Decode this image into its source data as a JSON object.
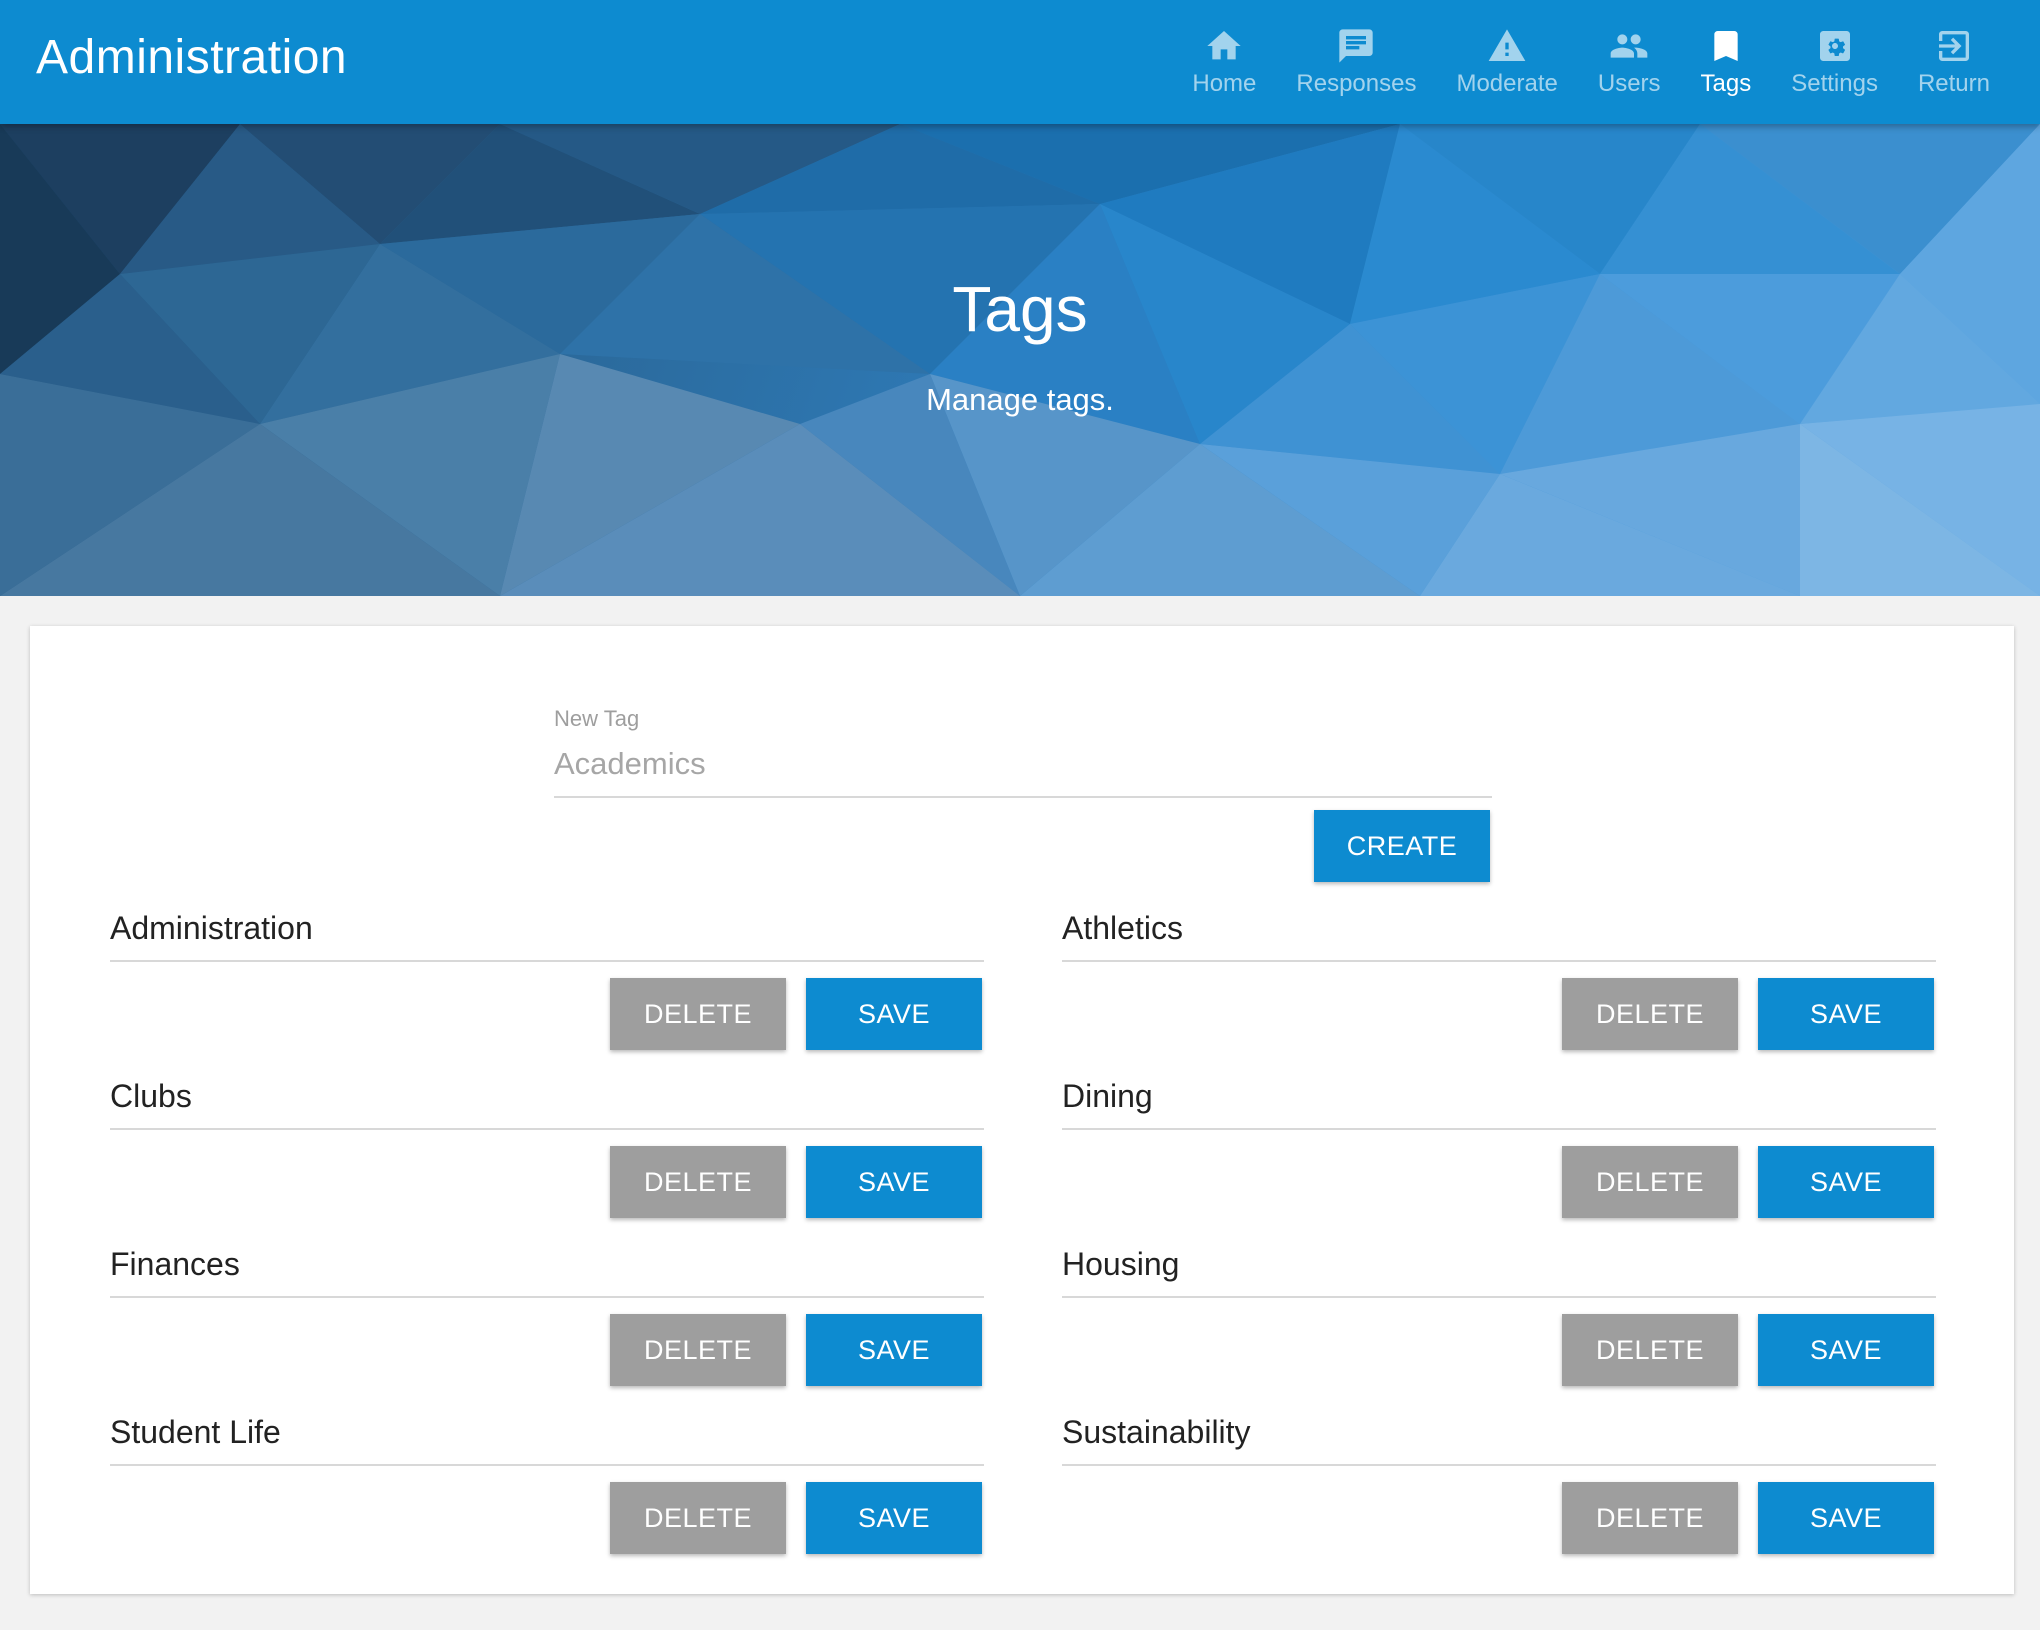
{
  "header": {
    "title": "Administration",
    "nav": [
      {
        "label": "Home",
        "icon": "home-icon",
        "active": false
      },
      {
        "label": "Responses",
        "icon": "chat-icon",
        "active": false
      },
      {
        "label": "Moderate",
        "icon": "warning-icon",
        "active": false
      },
      {
        "label": "Users",
        "icon": "users-icon",
        "active": false
      },
      {
        "label": "Tags",
        "icon": "bookmark-icon",
        "active": true
      },
      {
        "label": "Settings",
        "icon": "gear-icon",
        "active": false
      },
      {
        "label": "Return",
        "icon": "exit-icon",
        "active": false
      }
    ]
  },
  "hero": {
    "title": "Tags",
    "subtitle": "Manage tags."
  },
  "new_tag": {
    "label": "New Tag",
    "placeholder": "Academics",
    "value": "",
    "create_label": "CREATE"
  },
  "tags": [
    {
      "name": "Administration",
      "delete_label": "DELETE",
      "save_label": "SAVE"
    },
    {
      "name": "Athletics",
      "delete_label": "DELETE",
      "save_label": "SAVE"
    },
    {
      "name": "Clubs",
      "delete_label": "DELETE",
      "save_label": "SAVE"
    },
    {
      "name": "Dining",
      "delete_label": "DELETE",
      "save_label": "SAVE"
    },
    {
      "name": "Finances",
      "delete_label": "DELETE",
      "save_label": "SAVE"
    },
    {
      "name": "Housing",
      "delete_label": "DELETE",
      "save_label": "SAVE"
    },
    {
      "name": "Student Life",
      "delete_label": "DELETE",
      "save_label": "SAVE"
    },
    {
      "name": "Sustainability",
      "delete_label": "DELETE",
      "save_label": "SAVE"
    }
  ],
  "colors": {
    "primary": "#0d8bd0",
    "grey_button": "#9e9e9e",
    "page_background": "#f2f2f2"
  }
}
